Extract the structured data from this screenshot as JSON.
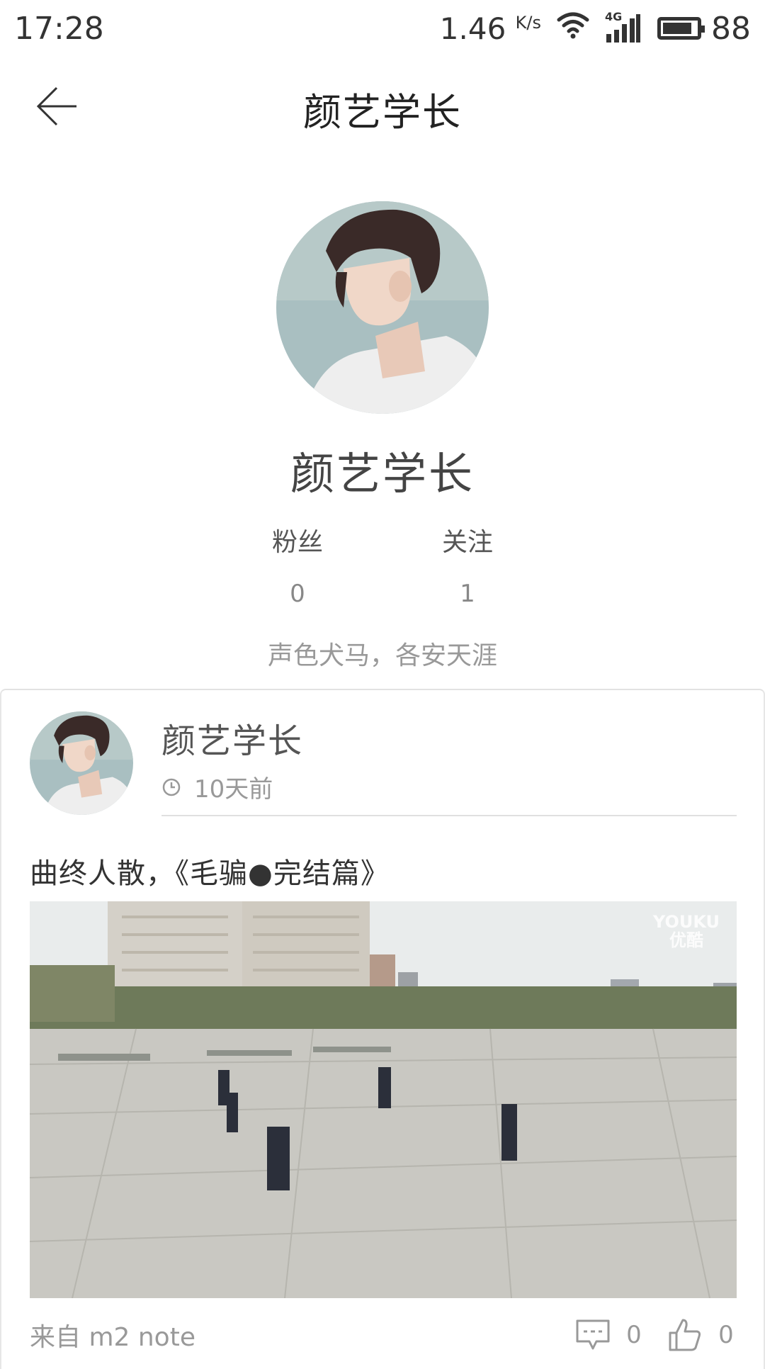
{
  "status_bar": {
    "time": "17:28",
    "net_speed_value": "1.46",
    "net_speed_unit": "K/s",
    "signal_label": "4G",
    "battery_level": "88"
  },
  "header": {
    "title": "颜艺学长"
  },
  "profile": {
    "name": "颜艺学长",
    "fans_label": "粉丝",
    "fans_count": "0",
    "follow_label": "关注",
    "follow_count": "1",
    "bio": "声色犬马，各安天涯"
  },
  "post": {
    "author": "颜艺学长",
    "time_ago": "10天前",
    "text": "曲终人散，《毛骗●完结篇》",
    "watermark_line1": "YOUKU",
    "watermark_line2": "优酷",
    "source": "来自 m2 note",
    "comments_count": "0",
    "likes_count": "0"
  },
  "icons": {
    "back": "arrow-left-icon",
    "clock": "clock-icon",
    "comment": "comment-icon",
    "like": "thumbs-up-icon",
    "wifi": "wifi-icon",
    "signal": "signal-icon",
    "battery": "battery-icon"
  }
}
